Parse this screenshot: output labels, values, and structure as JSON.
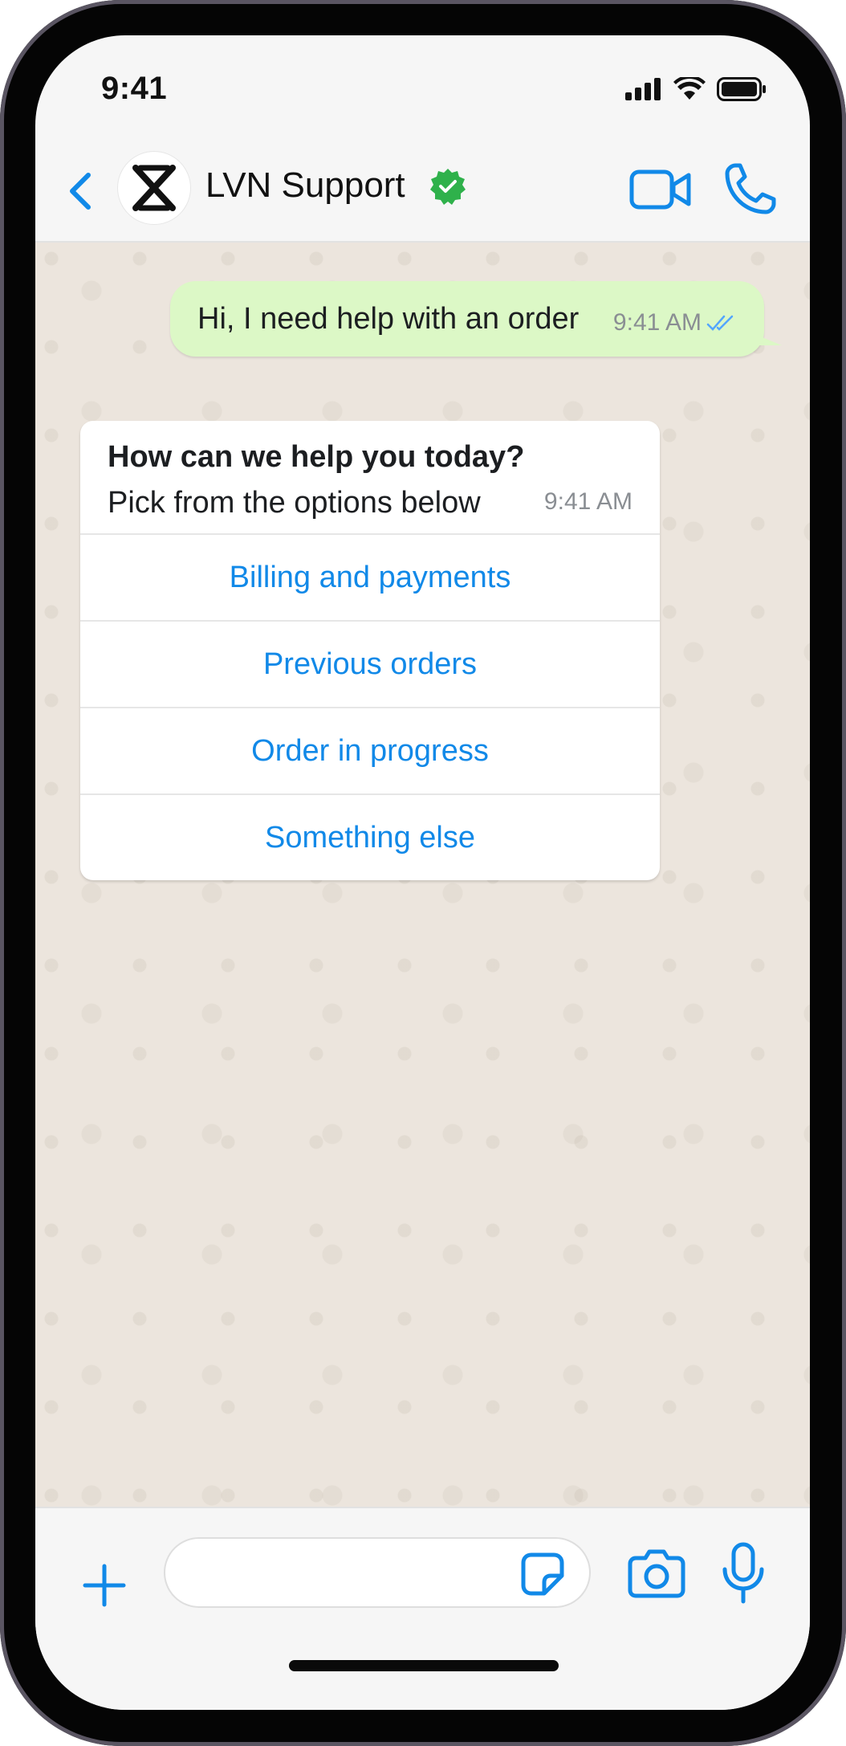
{
  "status_bar": {
    "time": "9:41",
    "icons": [
      "cellular-signal-icon",
      "wifi-icon",
      "battery-icon"
    ]
  },
  "header": {
    "back_icon": "chevron-left-icon",
    "contact_name": "LVN Support",
    "verified_icon": "verified-badge-icon",
    "video_icon": "video-camera-icon",
    "call_icon": "phone-icon"
  },
  "messages": {
    "outgoing": {
      "text": "Hi, I need help with an order",
      "time": "9:41 AM",
      "status_icon": "double-check-icon"
    },
    "incoming": {
      "title": "How can we help you today?",
      "subtitle": "Pick from the options below",
      "time": "9:41 AM",
      "options": [
        "Billing and payments",
        "Previous orders",
        "Order in progress",
        "Something else"
      ]
    }
  },
  "input_bar": {
    "placeholder": "",
    "icons": [
      "plus-icon",
      "sticker-icon",
      "camera-icon",
      "microphone-icon"
    ]
  },
  "colors": {
    "accent": "#1189E8",
    "outgoing_bubble": "#DCF8C6",
    "chat_background": "#ECE5DD",
    "verified": "#2FB14B"
  }
}
